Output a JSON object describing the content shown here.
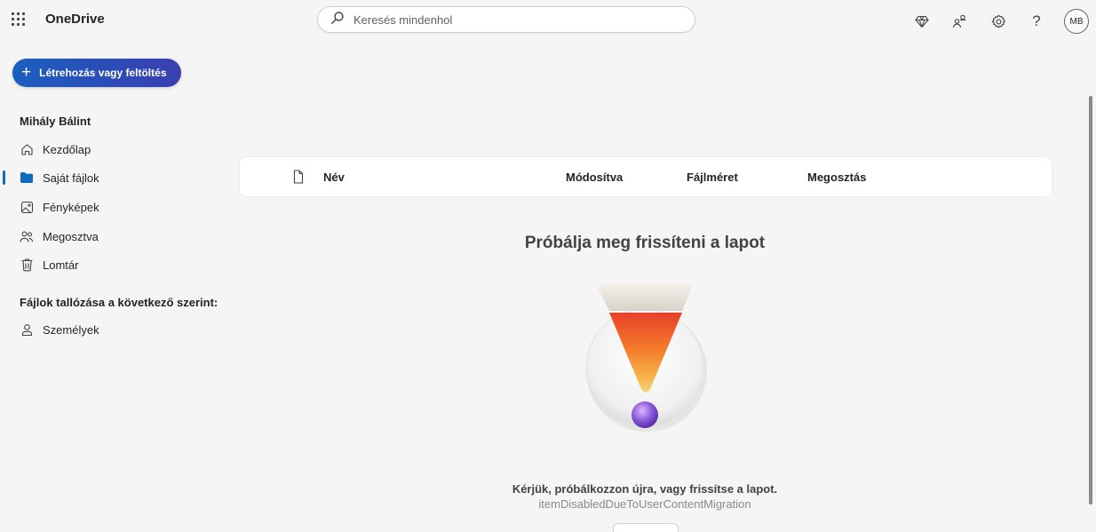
{
  "app": {
    "title": "OneDrive"
  },
  "search": {
    "placeholder": "Keresés mindenhol"
  },
  "top_icons": [
    "premium-diamond-icon",
    "share-people-icon",
    "settings-gear-icon",
    "help-icon"
  ],
  "account": {
    "initials": "MB"
  },
  "create": {
    "label": "Létrehozás vagy feltöltés"
  },
  "sidebar": {
    "user_name": "Mihály Bálint",
    "items": [
      {
        "label": "Kezdőlap",
        "icon": "home-icon",
        "active": false
      },
      {
        "label": "Saját fájlok",
        "icon": "folder-icon",
        "active": true
      },
      {
        "label": "Fényképek",
        "icon": "photo-icon",
        "active": false
      },
      {
        "label": "Megosztva",
        "icon": "people-icon",
        "active": false
      },
      {
        "label": "Lomtár",
        "icon": "trash-icon",
        "active": false
      }
    ],
    "browse_title": "Fájlok tallózása a következő szerint:",
    "browse_items": [
      {
        "label": "Személyek",
        "icon": "person-icon"
      }
    ]
  },
  "file_list": {
    "columns": {
      "name": "Név",
      "modified": "Módosítva",
      "size": "Fájlméret",
      "sharing": "Megosztás"
    }
  },
  "error": {
    "title": "Próbálja meg frissíteni a lapot",
    "message": "Kérjük, próbálkozzon újra, vagy frissítse a lapot.",
    "code": "itemDisabledDueToUserContentMigration"
  },
  "colors": {
    "accent": "#0f6cbd",
    "create_gradient_start": "#1a5fc0",
    "create_gradient_end": "#3a3fb0"
  }
}
